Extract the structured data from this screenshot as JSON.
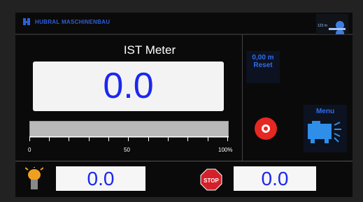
{
  "brand": {
    "name": "HUBRAL MASCHINENBAU"
  },
  "production_widget": {
    "count": "123 m"
  },
  "main": {
    "title": "IST Meter",
    "value": "0.0",
    "progress": {
      "percent": 0,
      "tick_labels": [
        "0",
        "50",
        "100%"
      ]
    }
  },
  "reset": {
    "line1": "0,00 m",
    "line2": "Reset"
  },
  "menu": {
    "label": "Menu"
  },
  "bottom": {
    "left_value": "0.0",
    "stop_label": "STOP",
    "right_value": "0.0"
  },
  "colors": {
    "value_blue": "#1b27f0",
    "label_blue": "#2f6df0",
    "stop_red": "#e52821",
    "lamp_orange": "#f0a020"
  },
  "icons": [
    "brand-logo-icon",
    "spool-icon",
    "record-stop-icon",
    "machine-icon",
    "signal-lamp-icon",
    "stop-sign-icon"
  ]
}
